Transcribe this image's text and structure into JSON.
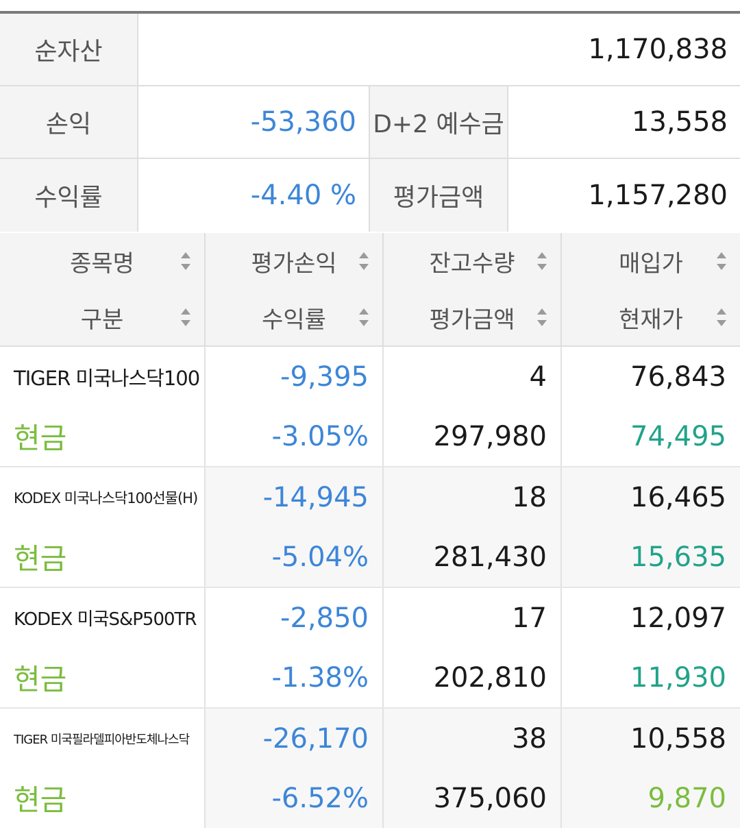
{
  "summary": {
    "net_asset_label": "순자산",
    "net_asset_value": "1,170,838",
    "pnl_label": "손익",
    "pnl_value": "-53,360",
    "deposit_label": "D+2 예수금",
    "deposit_value": "13,558",
    "return_label": "수익률",
    "return_value": "-4.40 %",
    "eval_label": "평가금액",
    "eval_value": "1,157,280"
  },
  "table": {
    "headers": [
      {
        "top": "종목명",
        "bottom": "구분"
      },
      {
        "top": "평가손익",
        "bottom": "수익률"
      },
      {
        "top": "잔고수량",
        "bottom": "평가금액"
      },
      {
        "top": "매입가",
        "bottom": "현재가"
      }
    ],
    "rows": [
      {
        "name": "TIGER 미국나스닥100",
        "type": "현금",
        "pnl": "-9,395",
        "rate": "-3.05%",
        "qty": "4",
        "eval": "297,980",
        "buy": "76,843",
        "cur": "74,495"
      },
      {
        "name": "KODEX 미국나스닥100선물(H)",
        "type": "현금",
        "pnl": "-14,945",
        "rate": "-5.04%",
        "qty": "18",
        "eval": "281,430",
        "buy": "16,465",
        "cur": "15,635"
      },
      {
        "name": "KODEX 미국S&P500TR",
        "type": "현금",
        "pnl": "-2,850",
        "rate": "-1.38%",
        "qty": "17",
        "eval": "202,810",
        "buy": "12,097",
        "cur": "11,930"
      },
      {
        "name": "TIGER 미국필라델피아반도체나스닥",
        "type": "현금",
        "pnl": "-26,170",
        "rate": "-6.52%",
        "qty": "38",
        "eval": "375,060",
        "buy": "10,558",
        "cur": "9,870"
      }
    ]
  },
  "colors": {
    "negative": "#3d86d8",
    "current_price": "#21a389",
    "category": "#7bbd3f"
  },
  "icons": {
    "sort": "sort-updown-icon"
  }
}
